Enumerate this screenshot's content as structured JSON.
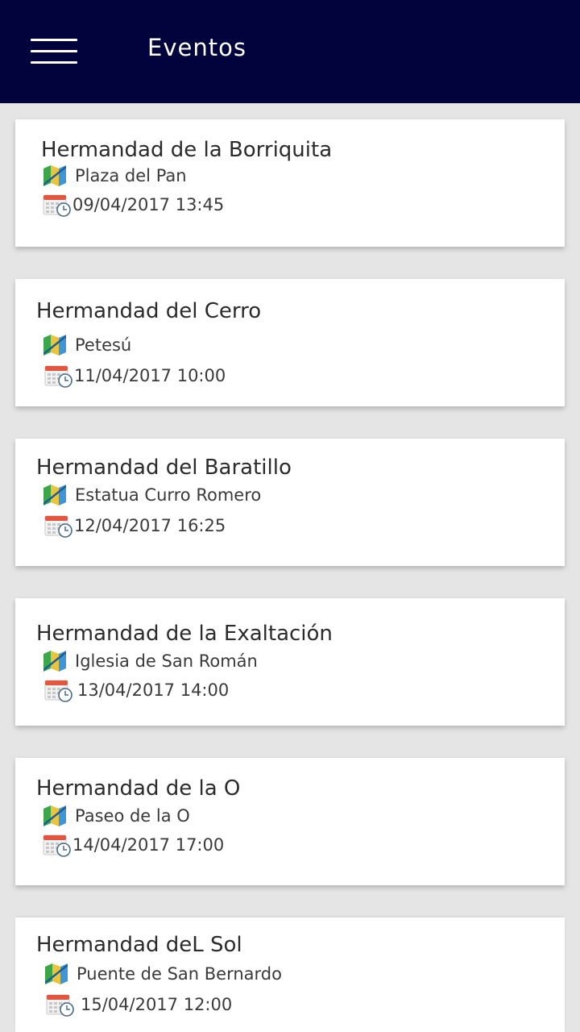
{
  "header": {
    "title": "Eventos",
    "menu_icon": "hamburger-menu-icon",
    "background_color": "#02033d"
  },
  "events": [
    {
      "name": "Hermandad de la Borriquita",
      "location": "Plaza del Pan",
      "datetime": "09/04/2017 13:45"
    },
    {
      "name": "Hermandad del Cerro",
      "location": "Petesú",
      "datetime": "11/04/2017 10:00"
    },
    {
      "name": "Hermandad del Baratillo",
      "location": "Estatua Curro Romero",
      "datetime": "12/04/2017 16:25"
    },
    {
      "name": "Hermandad de la Exaltación",
      "location": "Iglesia de San Román",
      "datetime": "13/04/2017 14:00"
    },
    {
      "name": "Hermandad de la O",
      "location": "Paseo de la O",
      "datetime": "14/04/2017 17:00"
    },
    {
      "name": "Hermandad deL Sol",
      "location": "Puente de San Bernardo",
      "datetime": "15/04/2017 12:00"
    }
  ],
  "icons": {
    "location": "map-icon",
    "date": "calendar-clock-icon"
  }
}
